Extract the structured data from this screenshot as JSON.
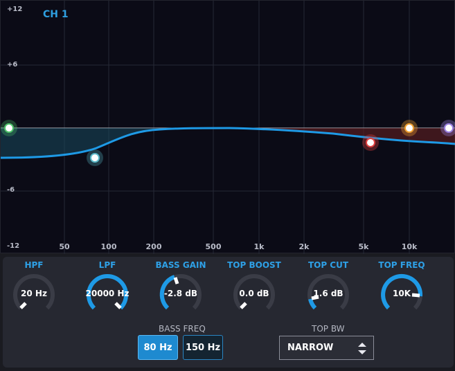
{
  "graph": {
    "channel_label": "CH 1",
    "y_labels": [
      "+12",
      "+6",
      "-6",
      "-12"
    ],
    "x_labels": [
      "50",
      "100",
      "200",
      "500",
      "1k",
      "2k",
      "5k",
      "10k"
    ]
  },
  "controls": {
    "knobs": [
      {
        "title": "HPF",
        "value": "20 Hz"
      },
      {
        "title": "LPF",
        "value": "20000 Hz"
      },
      {
        "title": "BASS GAIN",
        "value": "-2.8 dB"
      },
      {
        "title": "TOP BOOST",
        "value": "0.0 dB"
      },
      {
        "title": "TOP CUT",
        "value": "1.6 dB"
      },
      {
        "title": "TOP FREQ",
        "value": "10K"
      }
    ],
    "bass_freq": {
      "title": "BASS FREQ",
      "options": [
        "80 Hz",
        "150 Hz"
      ],
      "selected": "80 Hz"
    },
    "top_bw": {
      "title": "TOP BW",
      "value": "NARROW"
    }
  },
  "colors": {
    "accent": "#1e9ae6",
    "curve": "#1e9ae6",
    "node_hpf": "#4ec26a",
    "node_bass": "#5ab8c8",
    "node_topcut": "#e04040",
    "node_topfreq": "#f0a030",
    "node_lpf": "#9a80e0"
  }
}
